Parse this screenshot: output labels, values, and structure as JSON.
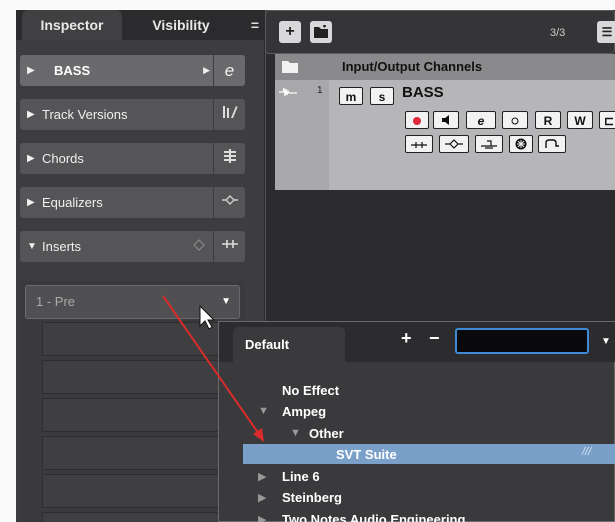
{
  "inspector": {
    "tab_inspector": "Inspector",
    "tab_visibility": "Visibility",
    "sections": {
      "bass": "BASS",
      "track_versions": "Track Versions",
      "chords": "Chords",
      "equalizers": "Equalizers",
      "inserts": "Inserts"
    },
    "insert_slot_1": "1 - Pre"
  },
  "project": {
    "counter": "3/3",
    "header": "Input/Output Channels",
    "track_number": "1",
    "track_name": "BASS",
    "btn_mute": "m",
    "btn_solo": "s",
    "btn_read": "R",
    "btn_write": "W"
  },
  "plugin_menu": {
    "tab": "Default",
    "search_value": "",
    "items": {
      "no_effect": "No Effect",
      "ampeg": "Ampeg",
      "other": "Other",
      "svt_suite": "SVT Suite",
      "line6": "Line 6",
      "steinberg": "Steinberg",
      "two_notes": "Two Notes Audio Engineering"
    }
  },
  "colors": {
    "selection": "#7aa0c9",
    "record": "#e0283c",
    "arrow": "#d92b2b",
    "search_border": "#3d8ad6"
  }
}
